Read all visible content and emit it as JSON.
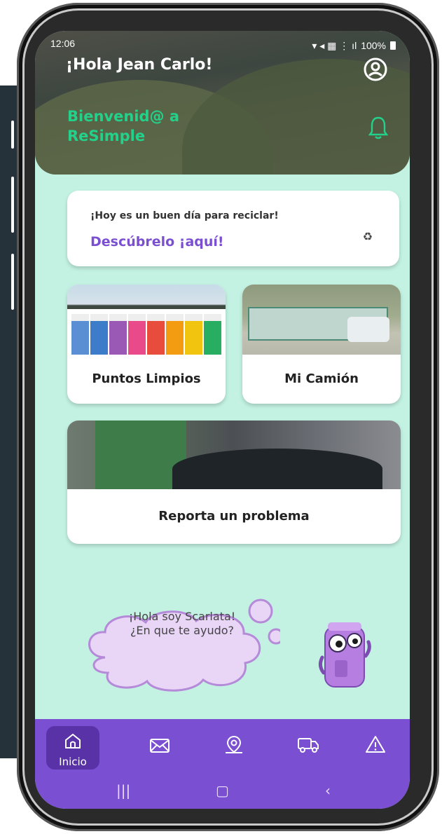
{
  "status_bar": {
    "time": "12:06",
    "battery": "100%"
  },
  "header": {
    "greeting": "¡Hola Jean Carlo!",
    "welcome_line1": "Bienvenid@ a",
    "welcome_line2": "ReSimple"
  },
  "tip_card": {
    "text": "¡Hoy es un buen día para reciclar!",
    "link": "Descúbrelo ¡aquí!",
    "icon": "recycle-icon"
  },
  "tiles": {
    "puntos": "Puntos Limpios",
    "camion": "Mi Camión",
    "reporta": "Reporta un problema"
  },
  "assistant": {
    "line1": "¡Hola soy Scarlata!",
    "line2": "¿En que te ayudo?"
  },
  "bottom_nav": {
    "items": [
      {
        "label": "Inicio",
        "icon": "home-icon",
        "active": true
      },
      {
        "label": "",
        "icon": "mail-icon"
      },
      {
        "label": "",
        "icon": "map-pin-icon"
      },
      {
        "label": "",
        "icon": "truck-icon"
      },
      {
        "label": "",
        "icon": "warning-icon"
      }
    ]
  },
  "colors": {
    "accent": "#7b4fd1",
    "welcome_green": "#23d18b",
    "background": "#c3f2e3"
  }
}
